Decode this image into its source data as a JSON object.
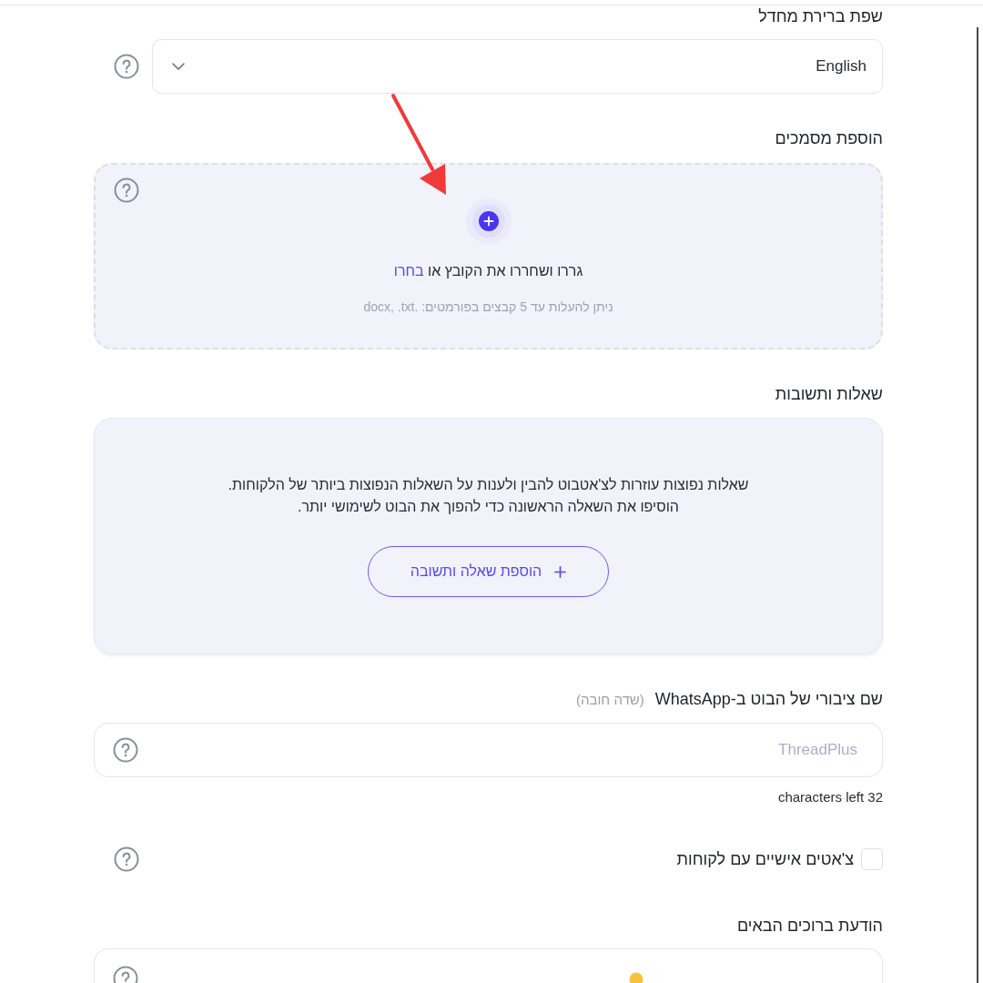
{
  "language_field": {
    "label": "שפת ברירת מחדל",
    "value": "English"
  },
  "documents": {
    "label": "הוספת מסמכים",
    "prompt": "גררו ושחררו את הקובץ או",
    "link": "בחרו",
    "hint": "ניתן להעלות עד 5 קבצים בפורמטים: .docx, .txt"
  },
  "faq": {
    "label": "שאלות ותשובות",
    "description": [
      "שאלות נפוצות עוזרות לצ'אטבוט להבין ולענות על השאלות הנפוצות ביותר של הלקוחות.",
      "הוסיפו את השאלה הראשונה כדי להפוך את הבוט לשימושי יותר."
    ],
    "button": "הוספת שאלה ותשובה"
  },
  "bot_name": {
    "label": "שם ציבורי של הבוט ב-WhatsApp",
    "required_note": "(שדה חובה)",
    "placeholder": "ThreadPlus",
    "counter": "characters left 32"
  },
  "personal_chats": {
    "label": "צ'אטים אישיים עם לקוחות",
    "checked": false
  },
  "welcome_message": {
    "label": "הודעת ברוכים הבאים"
  }
}
